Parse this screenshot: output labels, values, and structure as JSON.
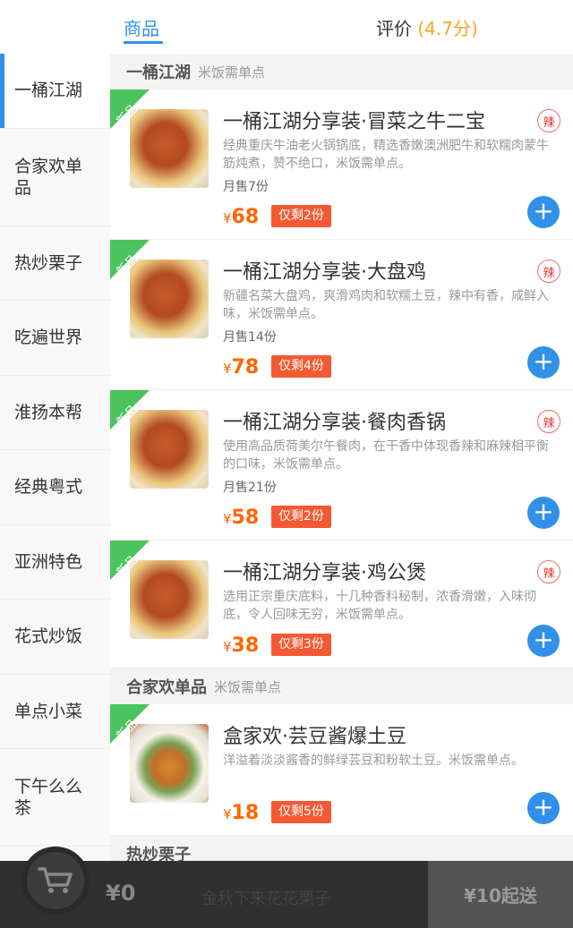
{
  "tabs": {
    "goods": "商品",
    "review": "评价",
    "review_score": "(4.7分)"
  },
  "sidebar": {
    "items": [
      {
        "label": "一桶江湖",
        "active": true
      },
      {
        "label": "合家欢单品"
      },
      {
        "label": "热炒栗子"
      },
      {
        "label": "吃遍世界"
      },
      {
        "label": "淮扬本帮"
      },
      {
        "label": "经典粤式"
      },
      {
        "label": "亚洲特色"
      },
      {
        "label": "花式炒饭"
      },
      {
        "label": "单点小菜"
      },
      {
        "label": "下午么么茶"
      }
    ]
  },
  "sections": [
    {
      "title": "一桶江湖",
      "subtitle": "米饭需单点",
      "items": [
        {
          "badge": "新品",
          "name": "一桶江湖分享装·冒菜之牛二宝",
          "spicy": "辣",
          "desc": "经典重庆牛油老火锅锅底，精选香嫩澳洲肥牛和软糯肉蒙牛筋炖煮，赞不绝口，米饭需单点。",
          "sold": "月售7份",
          "currency": "¥",
          "price": "68",
          "stock": "仅剩2份"
        },
        {
          "badge": "新品",
          "name": "一桶江湖分享装·大盘鸡",
          "spicy": "辣",
          "desc": "新疆名菜大盘鸡，爽滑鸡肉和软糯土豆，辣中有香，咸鲜入味，米饭需单点。",
          "sold": "月售14份",
          "currency": "¥",
          "price": "78",
          "stock": "仅剩4份"
        },
        {
          "badge": "新品",
          "name": "一桶江湖分享装·餐肉香锅",
          "spicy": "辣",
          "desc": "使用高品质荷美尔午餐肉，在干香中体现香辣和麻辣相平衡的口味，米饭需单点。",
          "sold": "月售21份",
          "currency": "¥",
          "price": "58",
          "stock": "仅剩2份"
        },
        {
          "badge": "新品",
          "name": "一桶江湖分享装·鸡公煲",
          "spicy": "辣",
          "desc": "选用正宗重庆底料，十几种香料秘制，浓香滑嫩，入味彻底，令人回味无穷，米饭需单点。",
          "sold": "",
          "currency": "¥",
          "price": "38",
          "stock": "仅剩3份"
        }
      ]
    },
    {
      "title": "合家欢单品",
      "subtitle": "米饭需单点",
      "items": [
        {
          "badge": "新品",
          "name": "盒家欢·芸豆酱爆土豆",
          "spicy": "",
          "desc": "洋溢着淡淡酱香的鲜绿芸豆和粉软土豆。米饭需单点。",
          "sold": "",
          "currency": "¥",
          "price": "18",
          "stock": "仅剩5份"
        }
      ]
    },
    {
      "title": "热炒栗子",
      "subtitle": ""
    }
  ],
  "cart": {
    "icon": "cart-icon",
    "total": "¥0",
    "peek_text": "金秋下来花花栗子",
    "checkout": "¥10起送"
  },
  "colors": {
    "accent": "#3190e8",
    "price": "#ff6600",
    "stock_tag": "#f35a33",
    "new_badge": "#4bc45f"
  }
}
